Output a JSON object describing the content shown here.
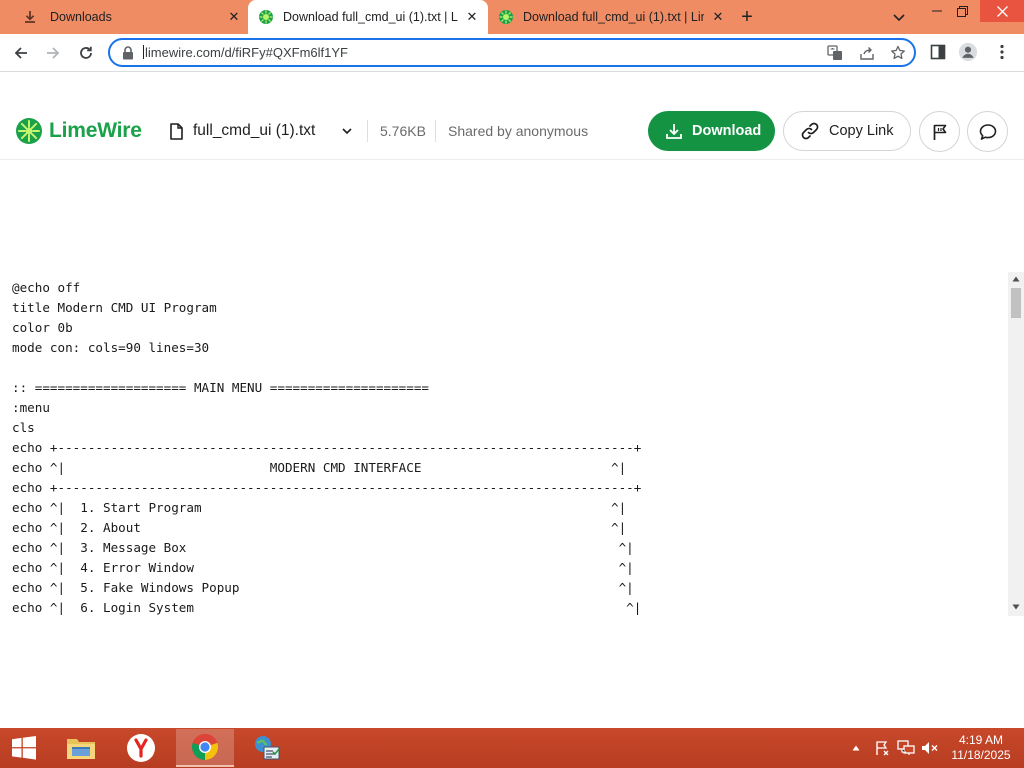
{
  "browser": {
    "tabs": [
      {
        "title": "Downloads",
        "close": "✕"
      },
      {
        "title": "Download full_cmd_ui (1).txt | Lin",
        "close": "✕"
      },
      {
        "title": "Download full_cmd_ui (1).txt | Lin",
        "close": "✕"
      }
    ],
    "new_tab": "+",
    "url": "limewire.com/d/fiRFy#QXFm6lf1YF"
  },
  "limewire": {
    "logo_text": "LimeWire",
    "file_name": "full_cmd_ui (1).txt",
    "file_size": "5.76KB",
    "shared_by": "Shared by anonymous",
    "download_label": "Download",
    "copy_link_label": "Copy Link",
    "brand_color": "#149443"
  },
  "file_content": {
    "lines": [
      "@echo off",
      "title Modern CMD UI Program",
      "color 0b",
      "mode con: cols=90 lines=30",
      "",
      ":: ==================== MAIN MENU =====================",
      ":menu",
      "cls",
      "echo +----------------------------------------------------------------------------+",
      "echo ^|                           MODERN CMD INTERFACE                         ^|",
      "echo +----------------------------------------------------------------------------+",
      "echo ^|  1. Start Program                                                      ^|",
      "echo ^|  2. About                                                              ^|",
      "echo ^|  3. Message Box                                                         ^|",
      "echo ^|  4. Error Window                                                        ^|",
      "echo ^|  5. Fake Windows Popup                                                  ^|",
      "echo ^|  6. Login System                                                         ^|"
    ]
  },
  "taskbar": {
    "time": "4:19 AM",
    "date": "11/18/2025"
  }
}
